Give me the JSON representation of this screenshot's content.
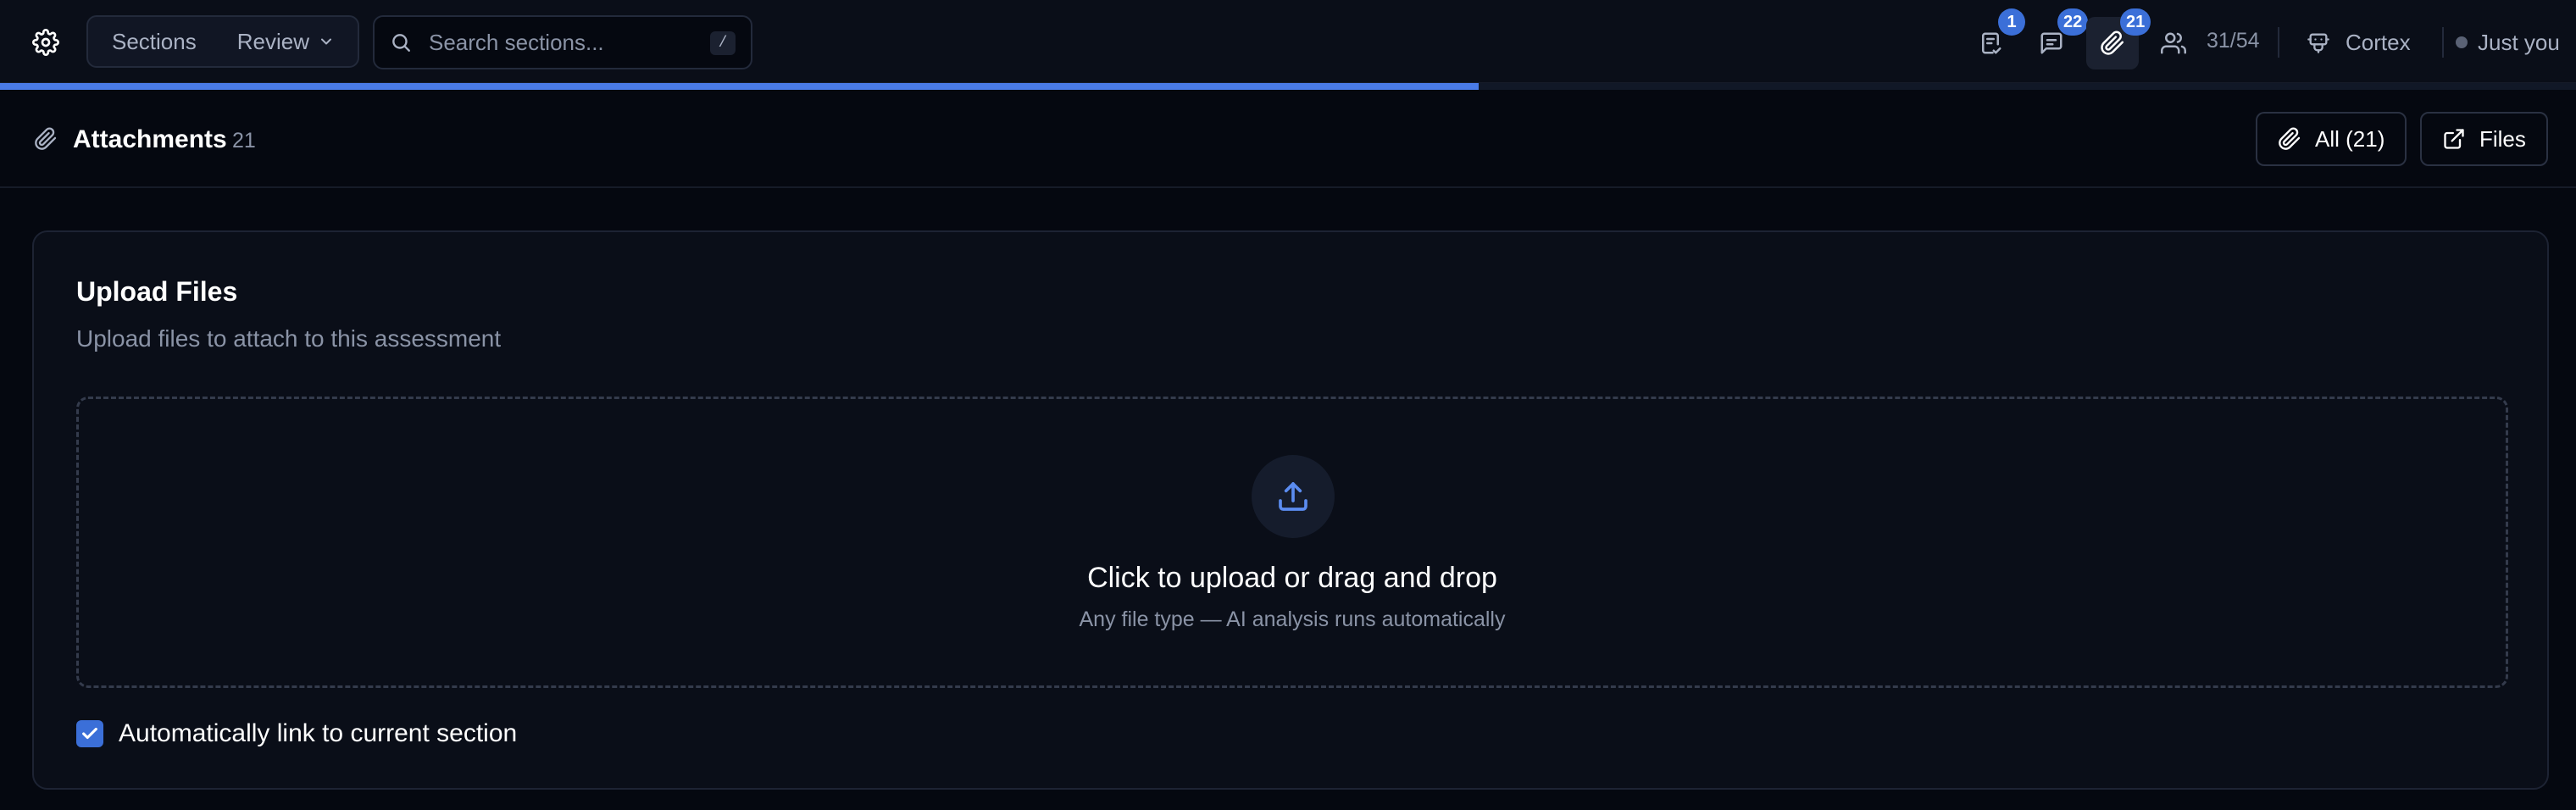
{
  "topbar": {
    "sections_label": "Sections",
    "review_label": "Review",
    "search_placeholder": "Search sections...",
    "search_shortcut": "/",
    "tasks_badge": "1",
    "comments_badge": "22",
    "attachments_badge": "21",
    "progress_count": "31/54",
    "progress_fraction": 0.574,
    "assistant_label": "Cortex",
    "presence_label": "Just you"
  },
  "header": {
    "title": "Attachments",
    "count": "21",
    "all_button": "All (21)",
    "files_button": "Files"
  },
  "upload": {
    "title": "Upload Files",
    "subtitle": "Upload files to attach to this assessment",
    "drop_title": "Click to upload or drag and drop",
    "drop_subtitle": "Any file type — AI analysis runs automatically",
    "auto_link_label": "Automatically link to current section",
    "auto_link_checked": true
  },
  "colors": {
    "accent": "#3b6fd8",
    "background": "#050810",
    "panel": "#0a0e18"
  },
  "icons": [
    "gear-icon",
    "chevron-down-icon",
    "search-icon",
    "task-check-icon",
    "comment-icon",
    "paperclip-icon",
    "users-icon",
    "robot-icon",
    "external-link-icon",
    "upload-icon",
    "check-icon"
  ]
}
